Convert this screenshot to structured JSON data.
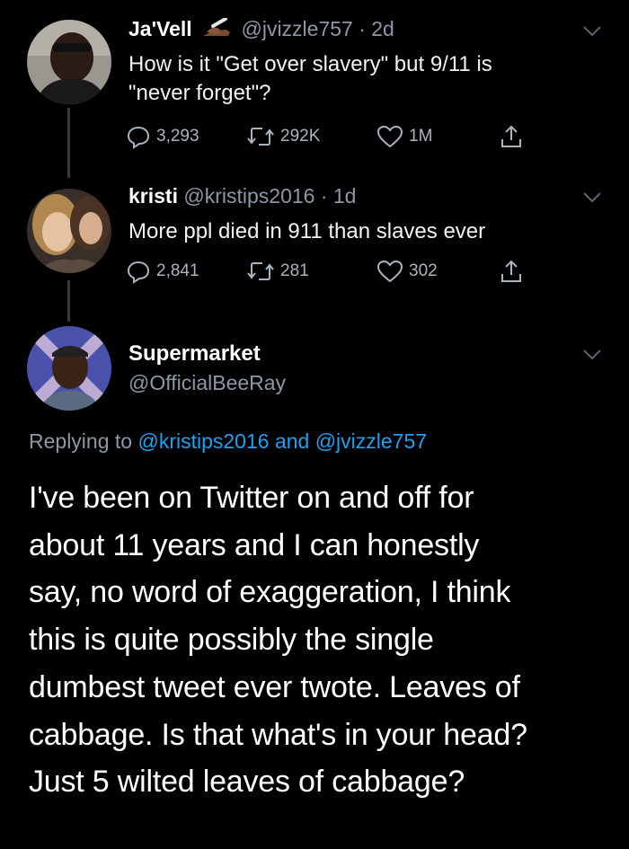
{
  "tweets": [
    {
      "name": "Ja'Vell",
      "handle": "@jvizzle757",
      "time": "· 2d",
      "text_line1": "How is it \"Get over slavery\" but 9/11 is",
      "text_line2": "\"never forget\"?",
      "replies": "3,293",
      "retweets": "292K",
      "likes": "1M"
    },
    {
      "name": "kristi",
      "handle": "@kristips2016",
      "time": "· 1d",
      "text_line1": "More ppl died in 911 than slaves ever",
      "replies": "2,841",
      "retweets": "281",
      "likes": "302"
    }
  ],
  "reply": {
    "name": "Supermarket",
    "handle": "@OfficialBeeRay",
    "replying_prefix": "Replying to",
    "mention1": "@kristips2016",
    "and_word": "and",
    "mention2": "@jvizzle757",
    "lines": [
      "I've been on Twitter on and off for",
      "about 11 years and I can honestly",
      "say, no word of exaggeration, I think",
      "this is quite possibly the single",
      "dumbest tweet ever twote. Leaves of",
      "cabbage. Is that what's in your head?",
      "Just 5 wilted leaves of cabbage?"
    ]
  },
  "colors": {
    "background": "#000000",
    "secondary_text": "#8b98a5",
    "link": "#1da1f2",
    "icon": "#aab4be"
  },
  "icons": [
    "reply-icon",
    "retweet-icon",
    "like-icon",
    "share-icon",
    "chevron-down-icon",
    "writing-hand-emoji"
  ]
}
